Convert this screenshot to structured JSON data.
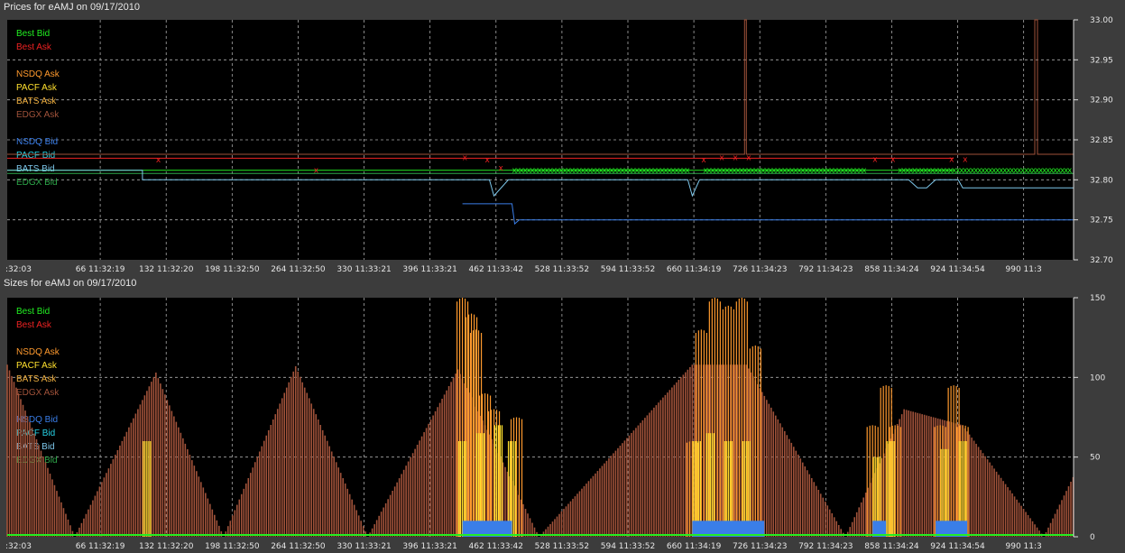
{
  "charts": [
    {
      "id": "prices",
      "title": "Prices for  eAMJ  on  09/17/2010"
    },
    {
      "id": "sizes",
      "title": "Sizes for  eAMJ  on  09/17/2010"
    }
  ],
  "x_ticks": [
    ":32:03",
    "66 11:32:19",
    "132 11:32:20",
    "198 11:32:50",
    "264 11:32:50",
    "330 11:33:21",
    "396 11:33:21",
    "462 11:33:42",
    "528 11:33:52",
    "594 11:33:52",
    "660 11:34:19",
    "726 11:34:23",
    "792 11:34:23",
    "858 11:34:24",
    "924 11:34:54",
    "990 11:3"
  ],
  "legend": [
    {
      "label": "Best Bid",
      "color": "#22ee22"
    },
    {
      "label": "Best Ask",
      "color": "#ee2222"
    },
    {
      "label": "NSDQ Ask",
      "color": "#ff9a2e"
    },
    {
      "label": "PACF Ask",
      "color": "#ffe02e"
    },
    {
      "label": "BATS Ask",
      "color": "#f0b040"
    },
    {
      "label": "EDGX Ask",
      "color": "#a0523a"
    },
    {
      "label": "NSDQ Bid",
      "color": "#3a7ee8"
    },
    {
      "label": "PACF Bid",
      "color": "#26d4e8"
    },
    {
      "label": "BATS Bid",
      "color": "#7ec8ec"
    },
    {
      "label": "EDGX Bid",
      "color": "#2ea84a"
    }
  ],
  "chart_data": [
    {
      "type": "line",
      "title": "Prices for  eAMJ  on  09/17/2010",
      "x_range": [
        0,
        1050
      ],
      "ylim": [
        32.7,
        33.0
      ],
      "y_ticks": [
        "33.00",
        "32.95",
        "32.90",
        "32.85",
        "32.80",
        "32.75",
        "32.70"
      ],
      "grid": true,
      "legend_position": "top-left",
      "series": [
        {
          "name": "Best Ask",
          "color": "#ee2222",
          "points": [
            [
              0,
              32.827
            ],
            [
              1050,
              32.827
            ]
          ]
        },
        {
          "name": "Best Bid",
          "color": "#22ee22",
          "points": [
            [
              0,
              32.812
            ],
            [
              1050,
              32.812
            ]
          ]
        },
        {
          "name": "EDGX Ask",
          "color": "#a0523a",
          "points": [
            [
              0,
              32.832
            ],
            [
              818,
              32.832
            ],
            [
              818,
              33.0
            ],
            [
              820,
              33.0
            ],
            [
              820,
              32.832
            ],
            [
              1140,
              32.832
            ],
            [
              1140,
              33.0
            ],
            [
              1143,
              33.0
            ],
            [
              1143,
              32.832
            ],
            [
              1183,
              32.832
            ]
          ]
        },
        {
          "name": "EDGX Bid",
          "color": "#2ea84a",
          "points": [
            [
              0,
              32.808
            ],
            [
              1183,
              32.808
            ]
          ]
        },
        {
          "name": "BATS Bid",
          "color": "#7ec8ec",
          "points": [
            [
              0,
              32.812
            ],
            [
              150,
              32.812
            ],
            [
              150,
              32.8
            ],
            [
              510,
              32.8
            ],
            [
              535,
              32.8
            ],
            [
              540,
              32.78
            ],
            [
              556,
              32.8
            ],
            [
              755,
              32.8
            ],
            [
              760,
              32.78
            ],
            [
              768,
              32.8
            ],
            [
              1000,
              32.8
            ],
            [
              1010,
              32.79
            ],
            [
              1020,
              32.79
            ],
            [
              1030,
              32.8
            ],
            [
              1055,
              32.8
            ],
            [
              1060,
              32.79
            ],
            [
              1183,
              32.79
            ]
          ]
        },
        {
          "name": "NSDQ Bid",
          "color": "#3a7ee8",
          "points": [
            [
              505,
              32.77
            ],
            [
              560,
              32.77
            ],
            [
              563,
              32.745
            ],
            [
              568,
              32.75
            ],
            [
              1183,
              32.75
            ]
          ]
        }
      ]
    },
    {
      "type": "bar",
      "title": "Sizes for  eAMJ  on  09/17/2010",
      "x_range": [
        0,
        1050
      ],
      "ylim": [
        0,
        150
      ],
      "y_ticks": [
        "150",
        "100",
        "50",
        "0"
      ],
      "grid": true,
      "legend_position": "top-left",
      "series": [
        {
          "name": "EDGX Ask",
          "color": "#a0523a",
          "peaks": [
            [
              0,
              108
            ],
            [
              75,
              0
            ],
            [
              165,
              103
            ],
            [
              240,
              0
            ],
            [
              320,
              107
            ],
            [
              400,
              0
            ],
            [
              500,
              105
            ],
            [
              590,
              0
            ],
            [
              760,
              108
            ],
            [
              820,
              108
            ],
            [
              930,
              0
            ],
            [
              995,
              80
            ],
            [
              1060,
              70
            ],
            [
              1150,
              0
            ],
            [
              1183,
              38
            ]
          ]
        },
        {
          "name": "NSDQ Ask",
          "color": "#ff9a2e",
          "bursts": [
            [
              505,
              150
            ],
            [
              515,
              140
            ],
            [
              520,
              130
            ],
            [
              530,
              90
            ],
            [
              540,
              80
            ],
            [
              565,
              75
            ],
            [
              760,
              60
            ],
            [
              770,
              130
            ],
            [
              785,
              150
            ],
            [
              800,
              145
            ],
            [
              815,
              150
            ],
            [
              830,
              120
            ],
            [
              960,
              70
            ],
            [
              975,
              95
            ],
            [
              985,
              70
            ],
            [
              1035,
              70
            ],
            [
              1050,
              95
            ],
            [
              1060,
              70
            ]
          ]
        },
        {
          "name": "PACF Ask",
          "color": "#ffe02e",
          "bursts": [
            [
              155,
              60
            ],
            [
              505,
              60
            ],
            [
              525,
              65
            ],
            [
              545,
              70
            ],
            [
              560,
              60
            ],
            [
              765,
              60
            ],
            [
              780,
              65
            ],
            [
              800,
              60
            ],
            [
              820,
              60
            ],
            [
              965,
              50
            ],
            [
              980,
              60
            ],
            [
              1040,
              55
            ],
            [
              1060,
              60
            ]
          ]
        },
        {
          "name": "Best Bid",
          "color": "#22ee22",
          "level": 1
        }
      ]
    }
  ]
}
